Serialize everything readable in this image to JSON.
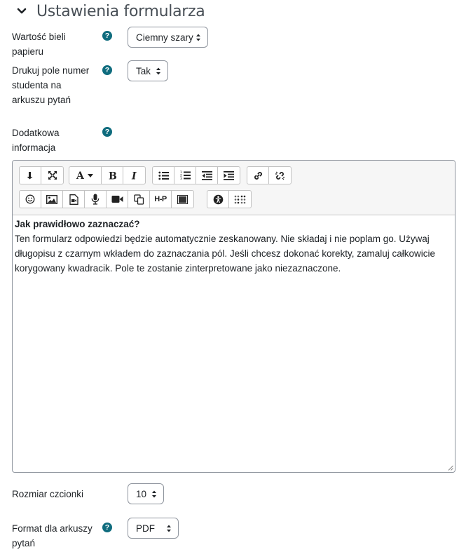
{
  "section": {
    "title": "Ustawienia formularza"
  },
  "fields": {
    "paper_white": {
      "label": "Wartość bieli papieru",
      "value": "Ciemny szary"
    },
    "print_student_number": {
      "label": "Drukuj pole numer studenta na arkuszu pytań",
      "value": "Tak"
    },
    "additional_info": {
      "label": "Dodatkowa informacja"
    },
    "font_size": {
      "label": "Rozmiar czcionki",
      "value": "10"
    },
    "sheet_format": {
      "label": "Format dla arkuszy pytań",
      "value": "PDF"
    }
  },
  "editor": {
    "content_heading": "Jak prawidłowo zaznaczać?",
    "content_body": "Ten formularz odpowiedzi będzie automatycznie zeskanowany. Nie składaj i nie poplam go. Używaj długopisu z czarnym wkładem do zaznaczania pól. Jeśli chcesz dokonać korekty, zamaluj całkowicie korygowany kwadracik. Pole te zostanie zinterpretowane jako niezaznaczone.",
    "h5p_label": "H-P"
  },
  "help_glyph": "?",
  "colors": {
    "help": "#0f6c7e",
    "border": "#8f959e",
    "toolbar_bg": "#f6f6f6"
  }
}
